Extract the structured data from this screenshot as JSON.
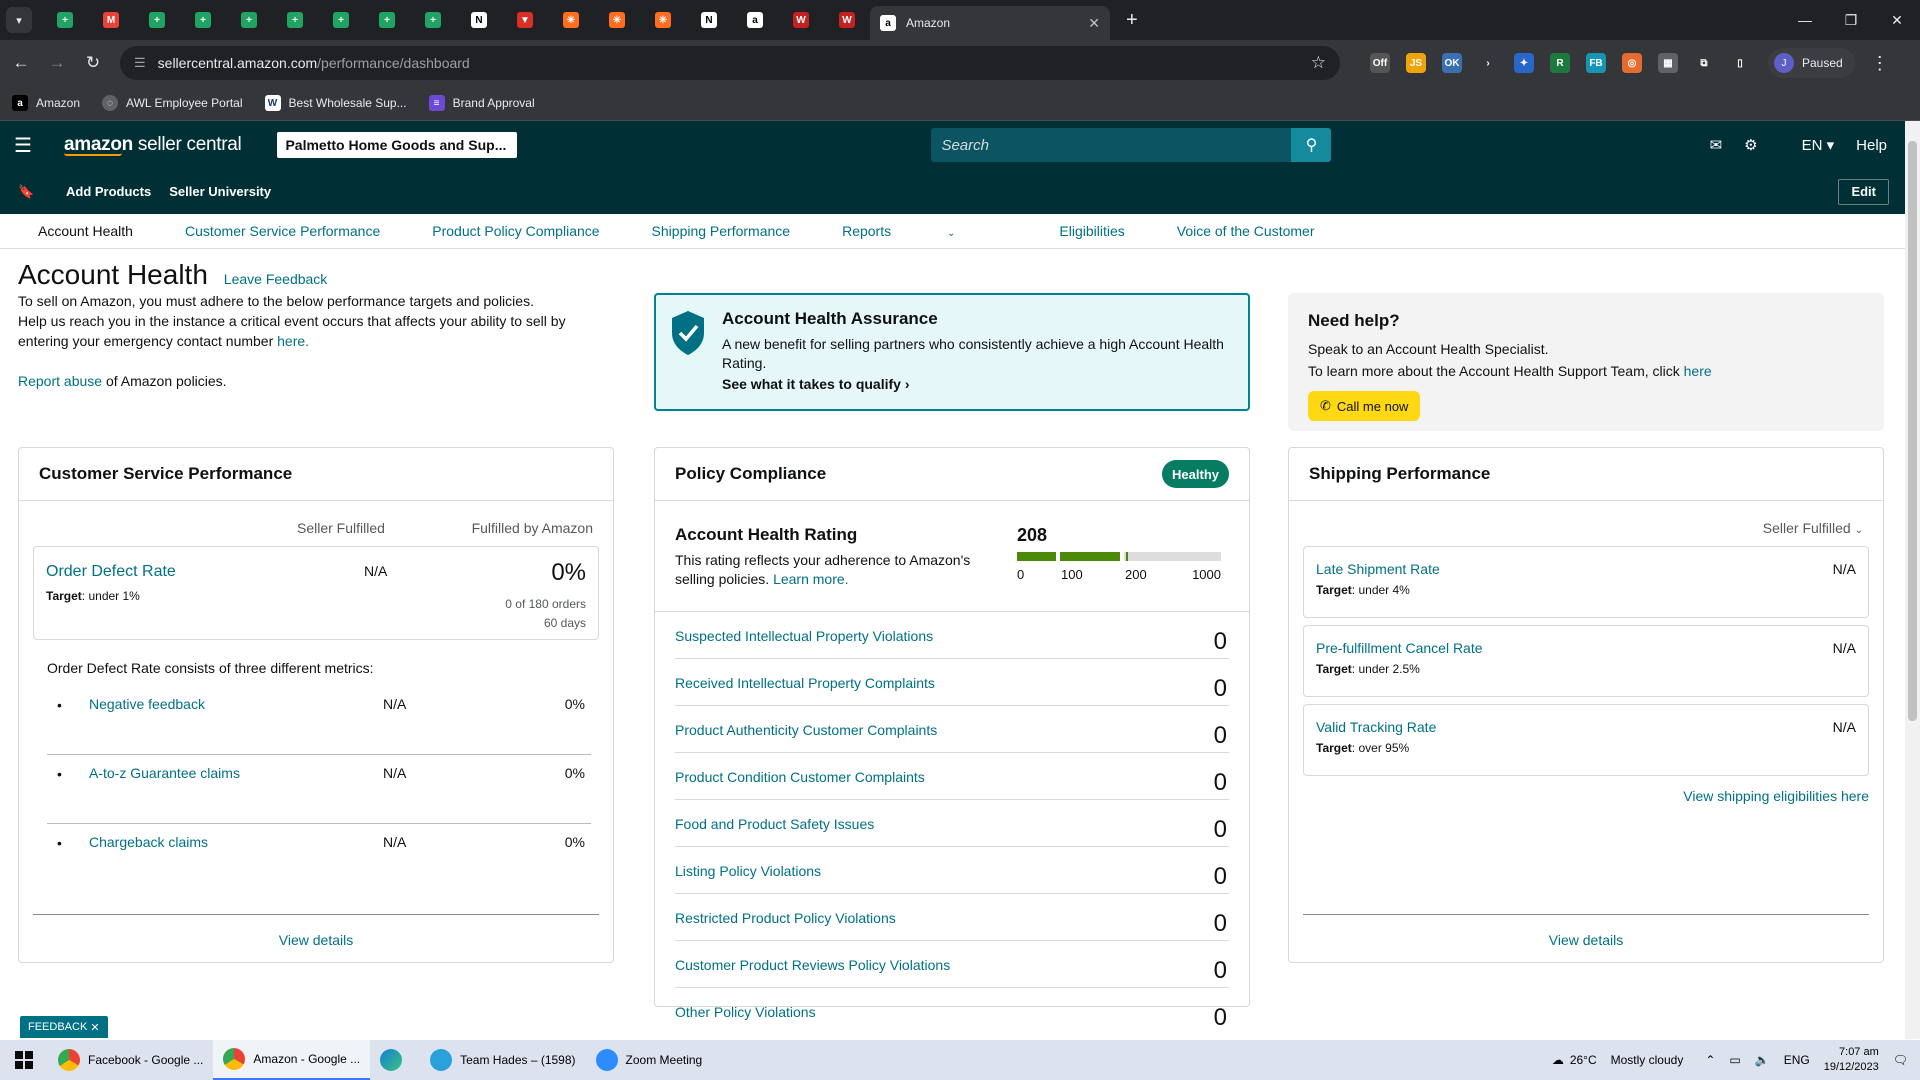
{
  "browser": {
    "active_tab_title": "Amazon",
    "pinned_tabs": [
      {
        "icon": "sheets-icon",
        "color": "#1fa463"
      },
      {
        "icon": "gmail-icon",
        "color": "#ea4335"
      },
      {
        "icon": "sheets-icon",
        "color": "#1fa463"
      },
      {
        "icon": "sheets-icon",
        "color": "#1fa463"
      },
      {
        "icon": "sheets-icon",
        "color": "#1fa463"
      },
      {
        "icon": "sheets-icon",
        "color": "#1fa463"
      },
      {
        "icon": "sheets-icon",
        "color": "#1fa463"
      },
      {
        "icon": "sheets-icon",
        "color": "#1fa463"
      },
      {
        "icon": "sheets-icon",
        "color": "#1fa463"
      },
      {
        "icon": "notion-icon",
        "color": "#ffffff"
      },
      {
        "icon": "app-icon",
        "color": "#d93025"
      },
      {
        "icon": "zapier-icon",
        "color": "#ff6d1f"
      },
      {
        "icon": "zapier-icon",
        "color": "#ff6d1f"
      },
      {
        "icon": "zapier-icon",
        "color": "#ff6d1f"
      },
      {
        "icon": "notion-icon",
        "color": "#ffffff"
      },
      {
        "icon": "amazon-icon",
        "color": "#ffffff"
      },
      {
        "icon": "w-icon",
        "color": "#c5221f"
      },
      {
        "icon": "w-icon",
        "color": "#c5221f"
      }
    ],
    "url_host": "sellercentral.amazon.com",
    "url_path": "/performance/dashboard",
    "profile_initial": "J",
    "profile_status": "Paused",
    "bookmarks": [
      {
        "label": "Amazon",
        "icon": "amazon-icon"
      },
      {
        "label": "AWL Employee Portal",
        "icon": "globe-icon"
      },
      {
        "label": "Best Wholesale Sup...",
        "icon": "wc-icon"
      },
      {
        "label": "Brand Approval",
        "icon": "list-icon"
      }
    ]
  },
  "header": {
    "logo_main": "amazon",
    "logo_rest": " seller central",
    "store_name": "Palmetto Home Goods and Sup...",
    "search_placeholder": "Search",
    "language": "EN",
    "help": "Help"
  },
  "subnav": {
    "links": [
      "Add Products",
      "Seller University"
    ],
    "edit": "Edit"
  },
  "page_tabs": [
    "Account Health",
    "Customer Service Performance",
    "Product Policy Compliance",
    "Shipping Performance",
    "Reports",
    "Eligibilities",
    "Voice of the Customer"
  ],
  "intro": {
    "title": "Account Health",
    "leave_feedback": "Leave Feedback",
    "line1": "To sell on Amazon, you must adhere to the below performance targets and policies.",
    "line2": "Help us reach you in the instance a critical event occurs that affects your ability to sell by entering your emergency contact number ",
    "here": "here.",
    "report_abuse": "Report abuse",
    "report_rest": " of Amazon policies."
  },
  "assurance": {
    "title": "Account Health Assurance",
    "desc": "A new benefit for selling partners who consistently achieve a high Account Health Rating.",
    "link": "See what it takes to qualify"
  },
  "need_help": {
    "title": "Need help?",
    "line1": "Speak to an Account Health Specialist.",
    "line2": "To learn more about the Account Health Support Team, click ",
    "here": "here",
    "button": "Call me now"
  },
  "csp": {
    "title": "Customer Service Performance",
    "col_seller": "Seller Fulfilled",
    "col_fba": "Fulfilled by Amazon",
    "odr_name": "Order Defect Rate",
    "odr_target_label": "Target",
    "odr_target": ": under 1%",
    "odr_seller": "N/A",
    "odr_fba": "0%",
    "odr_orders": "0 of 180 orders",
    "odr_days": "60 days",
    "consists": "Order Defect Rate consists of three different metrics:",
    "metrics": [
      {
        "name": "Negative feedback",
        "seller": "N/A",
        "fba": "0%"
      },
      {
        "name": "A-to-z Guarantee claims",
        "seller": "N/A",
        "fba": "0%"
      },
      {
        "name": "Chargeback claims",
        "seller": "N/A",
        "fba": "0%"
      }
    ],
    "view_details": "View details"
  },
  "policy": {
    "title": "Policy Compliance",
    "status": "Healthy",
    "ahr_title": "Account Health Rating",
    "ahr_desc": "This rating reflects your adherence to Amazon's selling policies. ",
    "learn_more": "Learn more.",
    "score": "208",
    "score_value": 208,
    "scale_ticks": [
      "0",
      "100",
      "200",
      "1000"
    ],
    "rows": [
      {
        "name": "Suspected Intellectual Property Violations",
        "count": "0"
      },
      {
        "name": "Received Intellectual Property Complaints",
        "count": "0"
      },
      {
        "name": "Product Authenticity Customer Complaints",
        "count": "0"
      },
      {
        "name": "Product Condition Customer Complaints",
        "count": "0"
      },
      {
        "name": "Food and Product Safety Issues",
        "count": "0"
      },
      {
        "name": "Listing Policy Violations",
        "count": "0"
      },
      {
        "name": "Restricted Product Policy Violations",
        "count": "0"
      },
      {
        "name": "Customer Product Reviews Policy Violations",
        "count": "0"
      },
      {
        "name": "Other Policy Violations",
        "count": "0"
      }
    ]
  },
  "shipping": {
    "title": "Shipping Performance",
    "selector": "Seller Fulfilled",
    "metrics": [
      {
        "name": "Late Shipment Rate",
        "target": ": under 4%",
        "value": "N/A"
      },
      {
        "name": "Pre-fulfillment Cancel Rate",
        "target": ": under 2.5%",
        "value": "N/A"
      },
      {
        "name": "Valid Tracking Rate",
        "target": ": over 95%",
        "value": "N/A"
      }
    ],
    "target_label": "Target",
    "eligibilities": "View shipping eligibilities here",
    "view_details": "View details"
  },
  "feedback_tab": "FEEDBACK",
  "taskbar": {
    "tasks": [
      {
        "label": "Facebook - Google ...",
        "color": "#ea4335"
      },
      {
        "label": "Amazon - Google ...",
        "color": "#ea4335"
      },
      {
        "label": "",
        "color": "#0f7fd8"
      },
      {
        "label": "Team Hades – (1598)",
        "color": "#2aa1da"
      },
      {
        "label": "Zoom Meeting",
        "color": "#2d8cff"
      }
    ],
    "weather": "26°C",
    "weather_desc": "Mostly cloudy",
    "lang": "ENG",
    "time": "7:07 am",
    "date": "19/12/2023"
  },
  "colors": {
    "header_bg": "#002f36",
    "link": "#007185",
    "healthy": "#067d62",
    "rating_green": "#4b8a08",
    "call_button": "#ffd814"
  }
}
